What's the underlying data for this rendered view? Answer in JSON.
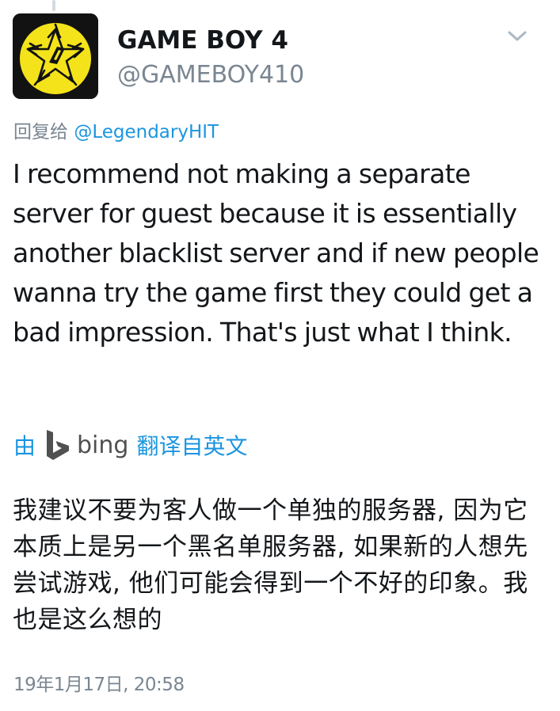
{
  "author": {
    "display_name": "GAME BOY 4",
    "handle": "@GAMEBOY410"
  },
  "reply": {
    "prefix": "回复给",
    "mention": "@LegendaryHIT"
  },
  "tweet": {
    "text": "I recommend not making a separate server for guest because it is essentially another blacklist server and if new people wanna try the game first they could get a bad impression. That's just what I think."
  },
  "translation": {
    "by_label": "由",
    "provider": "bing",
    "from_label": "翻译自英文",
    "text": "我建议不要为客人做一个单独的服务器, 因为它本质上是另一个黑名单服务器, 如果新的人想先尝试游戏, 他们可能会得到一个不好的印象。我也是这么想的"
  },
  "timestamp": "19年1月17日, 20:58",
  "colors": {
    "text": "#14171a",
    "secondary": "#7a8691",
    "link": "#1b95e0",
    "avatar_yellow": "#f4e31a",
    "avatar_bg": "#121212"
  },
  "icons": {
    "menu": "chevron-down-icon",
    "translator": "bing-logo-icon",
    "avatar": "star-emblem-icon"
  }
}
